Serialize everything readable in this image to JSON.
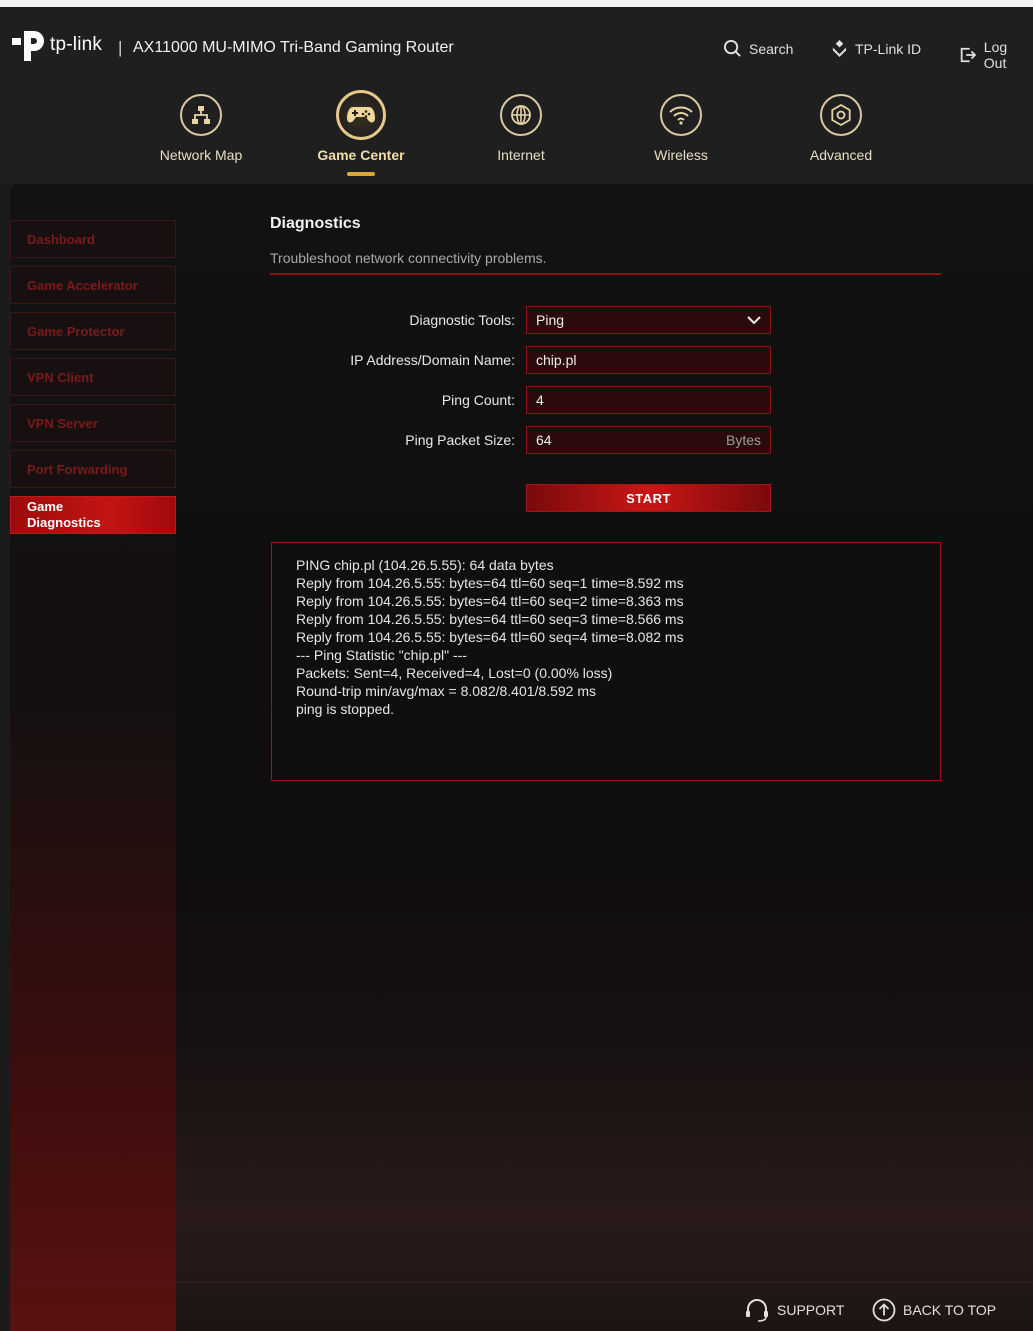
{
  "header": {
    "brand": "tp-link",
    "separator": "|",
    "model": "AX11000 MU-MIMO Tri-Band Gaming Router",
    "search_label": "Search",
    "tplink_id_label": "TP-Link ID",
    "logout_label": "Log Out"
  },
  "nav": [
    {
      "label": "Network Map",
      "icon": "network-map-icon"
    },
    {
      "label": "Game Center",
      "icon": "gamepad-icon",
      "active": true
    },
    {
      "label": "Internet",
      "icon": "globe-icon"
    },
    {
      "label": "Wireless",
      "icon": "wifi-icon"
    },
    {
      "label": "Advanced",
      "icon": "gear-icon"
    }
  ],
  "sidebar": {
    "items": [
      {
        "label": "Dashboard"
      },
      {
        "label": "Game Accelerator"
      },
      {
        "label": "Game Protector"
      },
      {
        "label": "VPN Client"
      },
      {
        "label": "VPN Server"
      },
      {
        "label": "Port Forwarding"
      },
      {
        "label_line1": "Game",
        "label_line2": "Diagnostics",
        "active": true
      }
    ]
  },
  "panel": {
    "title": "Diagnostics",
    "subtitle": "Troubleshoot network connectivity problems.",
    "form": {
      "tool_label": "Diagnostic Tools:",
      "tool_value": "Ping",
      "address_label": "IP Address/Domain Name:",
      "address_value": "chip.pl",
      "count_label": "Ping Count:",
      "count_value": "4",
      "size_label": "Ping Packet Size:",
      "size_value": "64",
      "size_unit": "Bytes",
      "start_label": "START"
    },
    "output": [
      "PING chip.pl (104.26.5.55): 64 data bytes",
      "Reply from 104.26.5.55: bytes=64 ttl=60 seq=1 time=8.592 ms",
      "Reply from 104.26.5.55: bytes=64 ttl=60 seq=2 time=8.363 ms",
      "Reply from 104.26.5.55: bytes=64 ttl=60 seq=3 time=8.566 ms",
      "Reply from 104.26.5.55: bytes=64 ttl=60 seq=4 time=8.082 ms",
      "--- Ping Statistic \"chip.pl\" ---",
      "Packets: Sent=4, Received=4, Lost=0 (0.00% loss)",
      "Round-trip min/avg/max = 8.082/8.401/8.592 ms",
      "ping is stopped."
    ]
  },
  "footer": {
    "support_label": "SUPPORT",
    "back_to_top_label": "BACK TO TOP"
  },
  "colors": {
    "accent_red": "#c31414",
    "nav_gold": "#e6c98a",
    "background": "#1b1b1b"
  }
}
